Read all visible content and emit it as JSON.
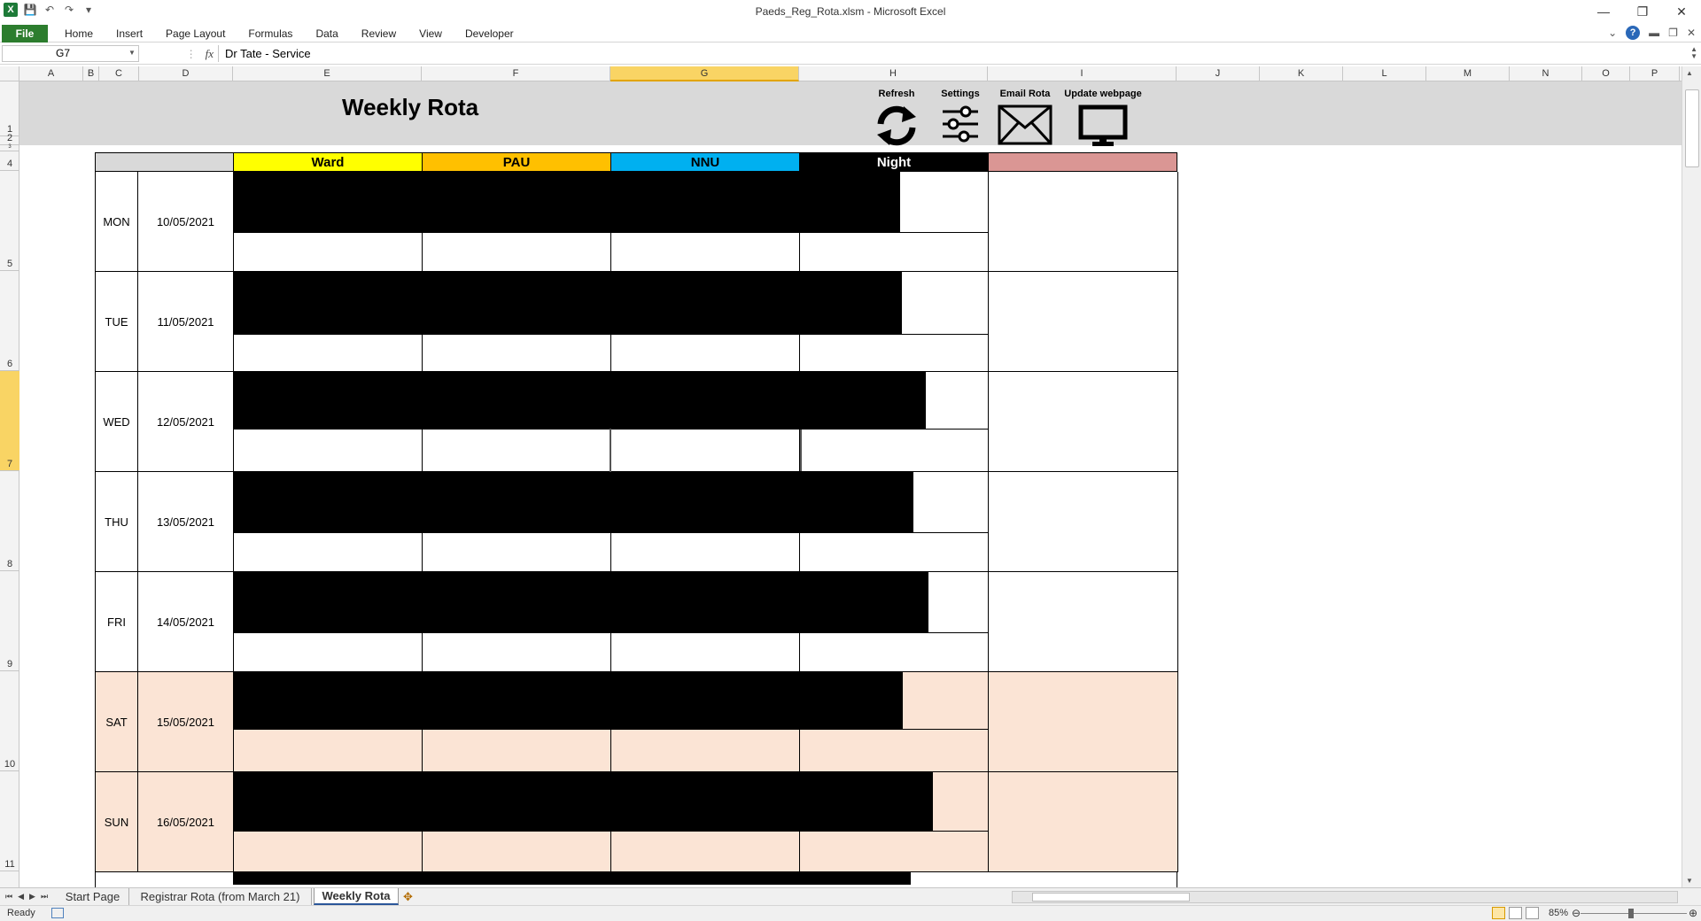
{
  "window": {
    "title": "Paeds_Reg_Rota.xlsm  -  Microsoft Excel",
    "app_icon": "excel-icon"
  },
  "ribbon": {
    "file_label": "File",
    "tabs": [
      "Home",
      "Insert",
      "Page Layout",
      "Formulas",
      "Data",
      "Review",
      "View",
      "Developer"
    ]
  },
  "formula_bar": {
    "name_box": "G7",
    "fx": "fx",
    "formula": "Dr Tate -  Service"
  },
  "columns": [
    "A",
    "B",
    "C",
    "D",
    "E",
    "F",
    "G",
    "H",
    "I",
    "J",
    "K",
    "L",
    "M",
    "N",
    "O",
    "P"
  ],
  "selected_column": "G",
  "rows": [
    "1",
    "2",
    "3",
    "4",
    "5",
    "6",
    "7",
    "8",
    "9",
    "10",
    "11"
  ],
  "selected_row": "7",
  "sheet": {
    "title": "Weekly Rota",
    "actions": [
      {
        "label": "Refresh",
        "icon": "refresh-icon"
      },
      {
        "label": "Settings",
        "icon": "sliders-icon"
      },
      {
        "label": "Email Rota",
        "icon": "envelope-icon"
      },
      {
        "label": "Update  webpage",
        "icon": "monitor-icon"
      }
    ],
    "headers": [
      {
        "label": "",
        "color": "#d9d9d9"
      },
      {
        "label": "Ward",
        "color": "#ffff00"
      },
      {
        "label": "PAU",
        "color": "#ffc000"
      },
      {
        "label": "NNU",
        "color": "#00b0f0"
      },
      {
        "label": "Night",
        "color": "#000000"
      },
      {
        "label": "",
        "color": "#da9694"
      }
    ],
    "days": [
      {
        "day": "MON",
        "date": "10/05/2021",
        "weekend": false
      },
      {
        "day": "TUE",
        "date": "11/05/2021",
        "weekend": false
      },
      {
        "day": "WED",
        "date": "12/05/2021",
        "weekend": false
      },
      {
        "day": "THU",
        "date": "13/05/2021",
        "weekend": false
      },
      {
        "day": "FRI",
        "date": "14/05/2021",
        "weekend": false
      },
      {
        "day": "SAT",
        "date": "15/05/2021",
        "weekend": true
      },
      {
        "day": "SUN",
        "date": "16/05/2021",
        "weekend": true
      }
    ],
    "weekend_color": "#fbe4d5"
  },
  "sheet_tabs": {
    "tabs": [
      "Start Page",
      "Registrar Rota (from March 21)",
      "Weekly Rota"
    ],
    "active": "Weekly Rota"
  },
  "status_bar": {
    "status": "Ready",
    "zoom": "85%"
  }
}
